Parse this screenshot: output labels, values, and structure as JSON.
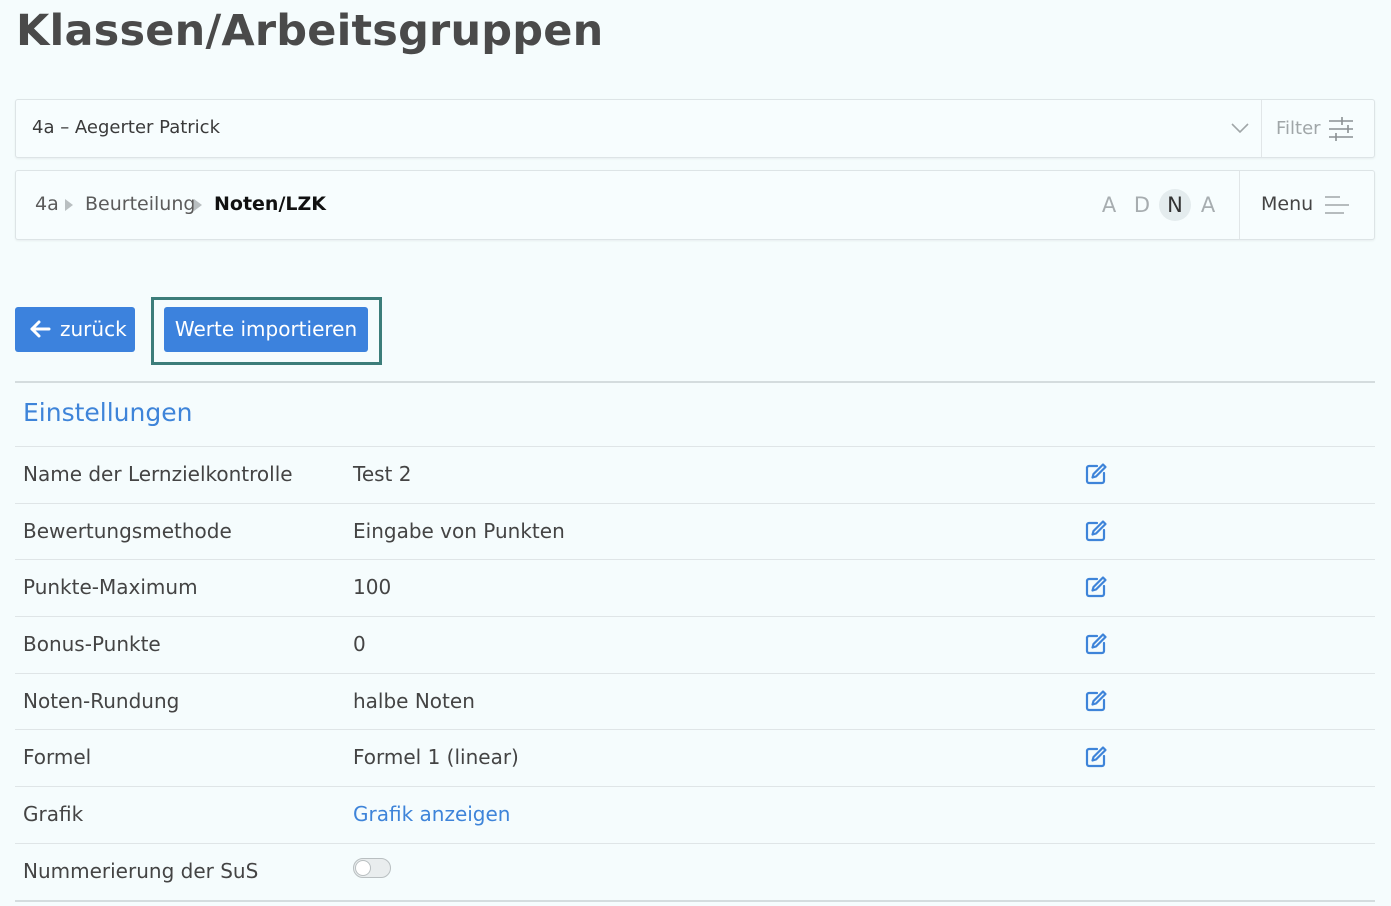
{
  "page": {
    "title": "Klassen/Arbeitsgruppen"
  },
  "select": {
    "value": "4a – Aegerter Patrick",
    "filter_label": "Filter"
  },
  "breadcrumb": {
    "items": [
      "4a",
      "Beurteilung",
      "Noten/LZK"
    ],
    "toggles": [
      "A",
      "D",
      "N",
      "A"
    ],
    "selected_toggle": "N",
    "menu_label": "Menu"
  },
  "actions": {
    "back_label": "zurück",
    "import_label": "Werte importieren"
  },
  "settings": {
    "title": "Einstellungen",
    "rows": [
      {
        "key": "Name der Lernzielkontrolle",
        "value": "Test 2"
      },
      {
        "key": "Bewertungsmethode",
        "value": "Eingabe von Punkten"
      },
      {
        "key": "Punkte-Maximum",
        "value": "100"
      },
      {
        "key": "Bonus-Punkte",
        "value": "0"
      },
      {
        "key": "Noten-Rundung",
        "value": "halbe Noten"
      },
      {
        "key": "Formel",
        "value": "Formel 1 (linear)"
      },
      {
        "key": "Grafik",
        "value": "Grafik anzeigen"
      },
      {
        "key": "Nummerierung der SuS",
        "value": "off"
      }
    ]
  },
  "colors": {
    "accent": "#3c82dd",
    "link": "#3e84d9",
    "highlight_frame": "#3c7d7a"
  }
}
